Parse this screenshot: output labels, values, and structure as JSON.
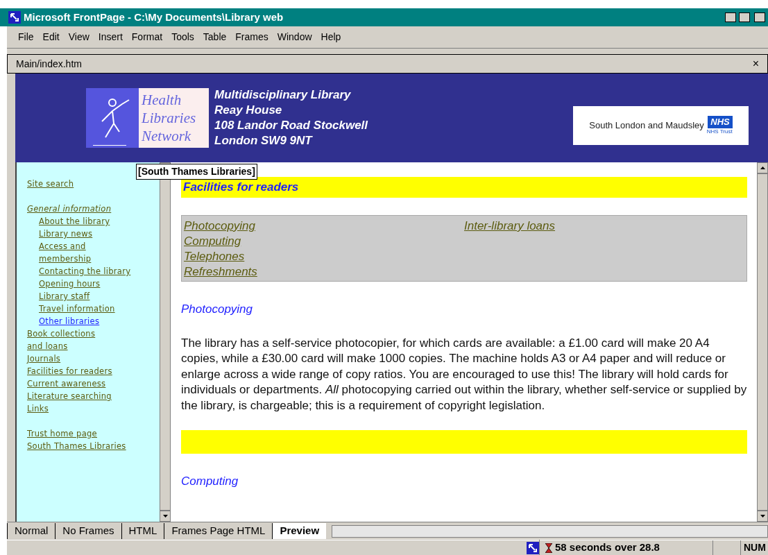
{
  "window": {
    "title": "Microsoft FrontPage - C:\\My Documents\\Library web"
  },
  "menu": [
    "File",
    "Edit",
    "View",
    "Insert",
    "Format",
    "Tools",
    "Table",
    "Frames",
    "Window",
    "Help"
  ],
  "document_tab": {
    "title": "Main/index.htm",
    "close": "×"
  },
  "banner": {
    "logo_lines": [
      "Health",
      "Libraries",
      "Network"
    ],
    "address": [
      "Multidisciplinary Library",
      "Reay House",
      "108 Landor Road Stockwell",
      "London SW9 9NT"
    ],
    "trust_logo": {
      "name": "South London and Maudsley",
      "badge": "NHS",
      "subtitle": "NHS Trust"
    }
  },
  "tooltip": "[South Thames Libraries]",
  "sidebar": {
    "groups": [
      [
        {
          "kind": "link",
          "lines": [
            "Site search"
          ],
          "selected": false
        }
      ],
      [
        {
          "kind": "heading",
          "lines": [
            "General information"
          ],
          "selected": false,
          "children": [
            {
              "lines": [
                "About the library"
              ],
              "selected": false
            },
            {
              "lines": [
                "Library news"
              ],
              "selected": false
            },
            {
              "lines": [
                "Access and",
                "membership"
              ],
              "selected": false
            },
            {
              "lines": [
                "Contacting the library"
              ],
              "selected": false
            },
            {
              "lines": [
                "Opening hours"
              ],
              "selected": false
            },
            {
              "lines": [
                "Library staff"
              ],
              "selected": false
            },
            {
              "lines": [
                "Travel information"
              ],
              "selected": false
            },
            {
              "lines": [
                "Other libraries"
              ],
              "selected": true
            }
          ]
        },
        {
          "kind": "link",
          "lines": [
            "Book collections",
            "and loans"
          ],
          "selected": false
        },
        {
          "kind": "link",
          "lines": [
            "Journals"
          ],
          "selected": false
        },
        {
          "kind": "link",
          "lines": [
            "Facilities for readers"
          ],
          "selected": false
        },
        {
          "kind": "link",
          "lines": [
            "Current awareness"
          ],
          "selected": false
        },
        {
          "kind": "link",
          "lines": [
            "Literature searching"
          ],
          "selected": false
        },
        {
          "kind": "link",
          "lines": [
            "Links"
          ],
          "selected": false
        }
      ],
      [
        {
          "kind": "link",
          "lines": [
            "Trust home page"
          ],
          "selected": false
        },
        {
          "kind": "link",
          "lines": [
            "South Thames Libraries"
          ],
          "selected": false
        }
      ]
    ]
  },
  "page": {
    "heading": "Facilities for readers",
    "contents": [
      [
        "Photocopying",
        "Computing",
        "Telephones",
        "Refreshments"
      ],
      [
        "Inter-library loans"
      ]
    ],
    "sections": [
      {
        "title": "Photocopying",
        "body": "The library has a self-service photocopier, for which cards are available: a £1.00 card will make 20 A4 copies, while a £30.00 card will make 1000 copies. The machine holds A3 or A4 paper and will reduce or enlarge across a wide range of copy ratios. You are encouraged to use this! The library will hold cards for individuals or departments. *All* photocopying carried out within the library, whether self-service or supplied by the library, is chargeable; this is a requirement of copyright legislation."
      },
      {
        "title": "Computing"
      }
    ]
  },
  "view_tabs": [
    {
      "label": "Normal",
      "selected": false
    },
    {
      "label": "No Frames",
      "selected": false
    },
    {
      "label": "HTML",
      "selected": false
    },
    {
      "label": "Frames Page HTML",
      "selected": false
    },
    {
      "label": "Preview",
      "selected": true
    }
  ],
  "status_bar": {
    "estimate": "58 seconds over 28.8",
    "num_lock": "NUM"
  }
}
